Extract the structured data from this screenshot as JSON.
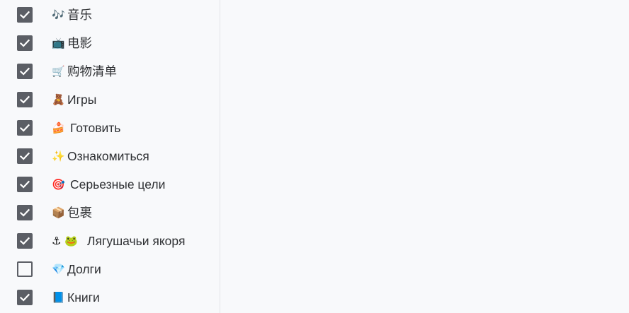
{
  "items": [
    {
      "emoji": "🎶",
      "label": "音乐",
      "checked": true
    },
    {
      "emoji": "📺",
      "label": "电影",
      "checked": true
    },
    {
      "emoji": "🛒",
      "label": "购物清单",
      "checked": true
    },
    {
      "emoji": "🧸",
      "label": "Игры",
      "checked": true
    },
    {
      "emoji": "🍰",
      "label": "Готовить",
      "checked": true
    },
    {
      "emoji": "✨",
      "label": "Ознакомиться",
      "checked": true
    },
    {
      "emoji": "🎯",
      "label": "Серьезные цели",
      "checked": true
    },
    {
      "emoji": "📦",
      "label": "包裹",
      "checked": true
    },
    {
      "emoji": "⚓ 🐸",
      "label": "Лягушачьи якоря",
      "checked": true
    },
    {
      "emoji": "💎",
      "label": "Долги",
      "checked": false
    },
    {
      "emoji": "📘",
      "label": "Книги",
      "checked": true
    }
  ]
}
